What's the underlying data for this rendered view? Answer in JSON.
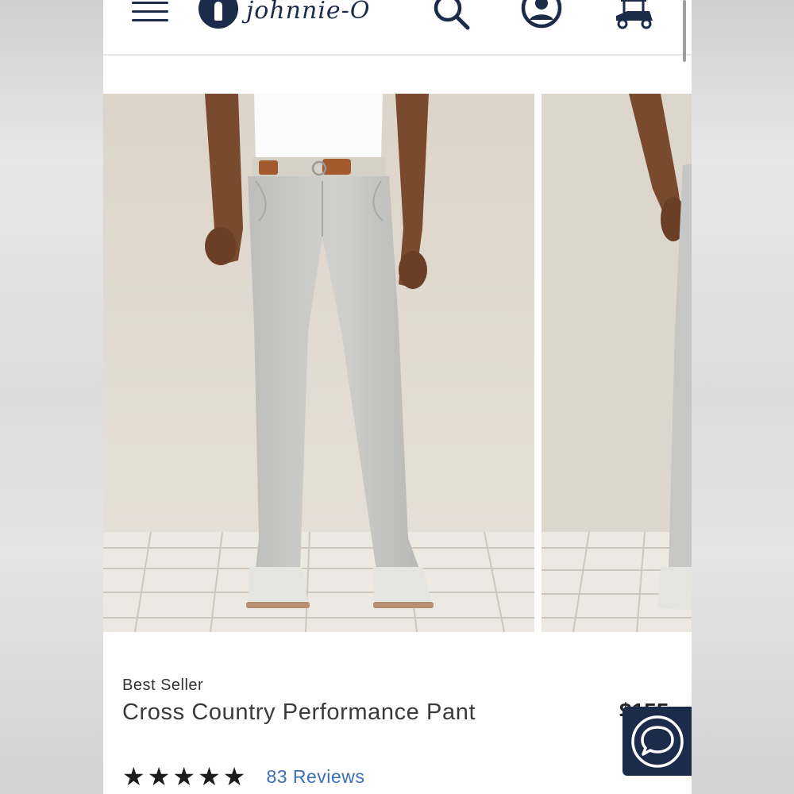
{
  "header": {
    "brand_name": "johnnie-O",
    "menu_icon": "hamburger-menu-icon",
    "search_icon": "search-icon",
    "account_icon": "account-icon",
    "cart_icon": "golf-cart-icon"
  },
  "product": {
    "badge": "Best Seller",
    "name": "Cross Country Performance Pant",
    "price": "$155",
    "rating": {
      "stars": 5,
      "max": 5,
      "reviews_label": "83 Reviews"
    }
  },
  "gallery": {
    "images": [
      "front view of light grey pants on model",
      "back view of light grey pants on model"
    ]
  },
  "chat": {
    "icon": "chat-bubble-icon"
  },
  "colors": {
    "brand_navy": "#1c2b4a",
    "link_blue": "#3b6fb2",
    "pant_grey": "#c9c9c7",
    "backdrop": "#e2dbd1"
  }
}
